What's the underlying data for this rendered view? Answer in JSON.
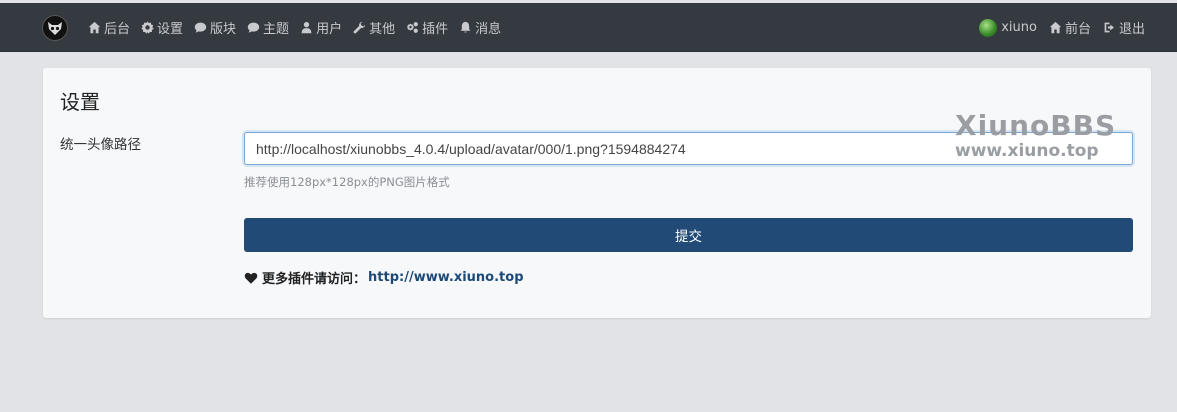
{
  "nav": {
    "logo_icon": "cat-mask-logo-icon",
    "items": [
      {
        "label": "后台",
        "icon": "home-icon"
      },
      {
        "label": "设置",
        "icon": "gear-icon"
      },
      {
        "label": "版块",
        "icon": "comment-icon"
      },
      {
        "label": "主题",
        "icon": "comment-icon"
      },
      {
        "label": "用户",
        "icon": "user-icon"
      },
      {
        "label": "其他",
        "icon": "wrench-icon"
      },
      {
        "label": "插件",
        "icon": "cogs-icon"
      },
      {
        "label": "消息",
        "icon": "bell-icon"
      }
    ],
    "right": {
      "username": "xiuno",
      "frontend": "前台",
      "logout": "退出"
    }
  },
  "page": {
    "title": "设置",
    "field_label": "统一头像路径",
    "field_value": "http://localhost/xiunobbs_4.0.4/upload/avatar/000/1.png?1594884274",
    "help": "推荐使用128px*128px的PNG图片格式",
    "submit": "提交",
    "more_text": "更多插件请访问：",
    "more_link": "http://www.xiuno.top"
  },
  "watermark": {
    "line1": "XiunoBBS",
    "line2": "www.xiuno.top"
  },
  "colors": {
    "topbar": "#343a40",
    "page_bg": "#e1e3e6",
    "button": "#214b76"
  }
}
